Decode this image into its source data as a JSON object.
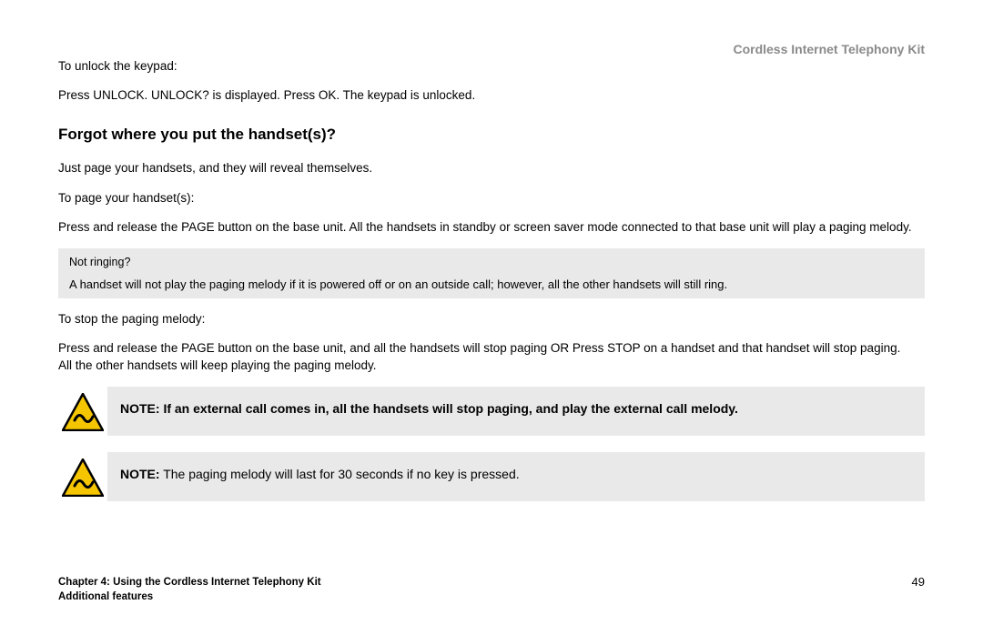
{
  "header": {
    "product": "Cordless Internet Telephony Kit"
  },
  "body": {
    "unlock_intro": "To unlock the keypad:",
    "unlock_steps": "Press UNLOCK. UNLOCK? is displayed. Press OK. The keypad is unlocked.",
    "heading": "Forgot where you put the handset(s)?",
    "page_intro": "Just page your handsets, and they will reveal themselves.",
    "page_label": "To page your handset(s):",
    "page_steps": "Press and release the PAGE button on the base unit. All the handsets in standby or screen saver mode connected to that base unit will play a paging melody.",
    "notringing_title": "Not ringing?",
    "notringing_body": "A handset will not play the paging melody if it is powered off or on an outside call; however, all the other handsets will still ring.",
    "stop_label": "To stop the paging melody:",
    "stop_steps": "Press and release the PAGE button on the base unit, and all the handsets will stop paging OR Press STOP on a handset and that handset will stop paging. All the other handsets will keep playing the paging melody.",
    "note1_prefix": "NOTE:",
    "note1_body": " If an external call comes in, all the handsets will stop paging, and play the external call melody.",
    "note2_prefix": "NOTE:",
    "note2_body": " The paging melody will last for 30 seconds if no key is pressed."
  },
  "footer": {
    "chapter": "Chapter 4: Using the Cordless Internet Telephony Kit",
    "section": "Additional features",
    "page": "49"
  }
}
